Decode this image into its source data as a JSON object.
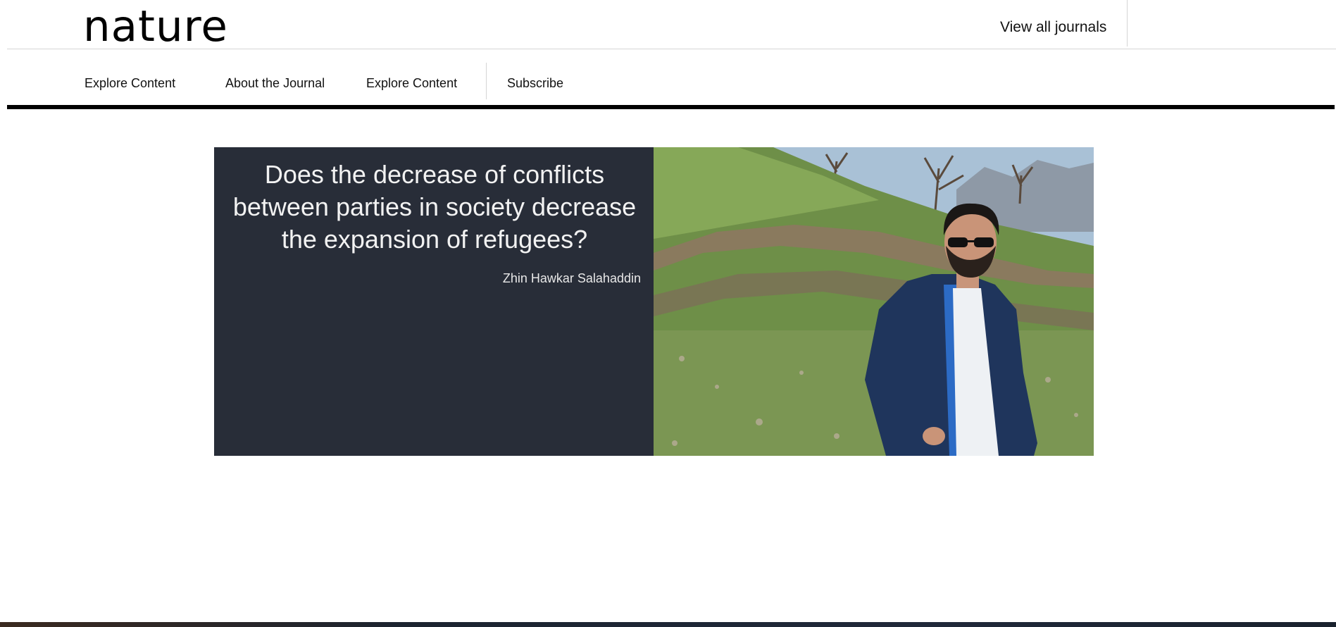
{
  "header": {
    "logo": "nature",
    "view_all_journals": "View all journals"
  },
  "nav": {
    "items": [
      {
        "label": "Explore Content"
      },
      {
        "label": "About the Journal"
      },
      {
        "label": "Explore Content"
      },
      {
        "label": "Subscribe"
      }
    ]
  },
  "hero": {
    "title": "Does the decrease of conflicts between parties in society decrease the expansion of refugees?",
    "author": "Zhin Hawkar Salahaddin",
    "image_icon": "person-photo",
    "colors": {
      "panel_background": "#282d38",
      "title_text": "#f2f2f2"
    }
  }
}
